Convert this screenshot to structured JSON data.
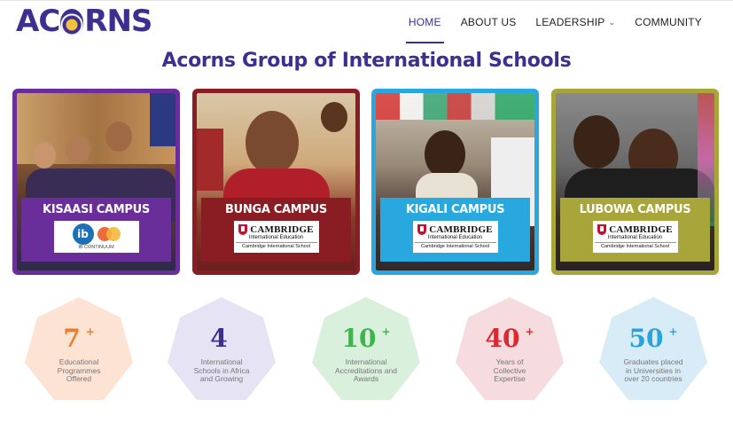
{
  "brand": {
    "logo_text_left": "AC",
    "logo_text_right": "RNS"
  },
  "nav": {
    "items": [
      {
        "label": "HOME",
        "active": true
      },
      {
        "label": "ABOUT US",
        "active": false
      },
      {
        "label": "LEADERSHIP",
        "active": false,
        "has_dropdown": true
      },
      {
        "label": "COMMUNITY",
        "active": false
      }
    ],
    "dropdown_icon": "chevron-down-icon"
  },
  "page": {
    "title": "Acorns Group of International Schools"
  },
  "campuses": [
    {
      "name": "KISAASI CAMPUS",
      "frame_color": "#6a2e9b",
      "badge_color": "#6a2e9b",
      "logo": "ib-mastercard",
      "ib_text": "IB CONTINUUM"
    },
    {
      "name": "BUNGA CAMPUS",
      "frame_color": "#8a1c23",
      "badge_color": "#8a1c23",
      "logo": "cambridge",
      "cambridge_word": "CAMBRIDGE",
      "cambridge_sub": "International Education",
      "cambridge_foot": "Cambridge International School"
    },
    {
      "name": "KIGALI CAMPUS",
      "frame_color": "#29a8e0",
      "badge_color": "#29a8e0",
      "logo": "cambridge",
      "cambridge_word": "CAMBRIDGE",
      "cambridge_sub": "International Education",
      "cambridge_foot": "Cambridge International School"
    },
    {
      "name": "LUBOWA CAMPUS",
      "frame_color": "#a8a53a",
      "badge_color": "#a8a53a",
      "logo": "cambridge",
      "cambridge_word": "CAMBRIDGE",
      "cambridge_sub": "International Education",
      "cambridge_foot": "Cambridge International School"
    }
  ],
  "stats": [
    {
      "value": "7",
      "plus": "+",
      "label": "Educational Programmes Offered",
      "color": "#f07b2a",
      "bg": "#fde3d4"
    },
    {
      "value": "4",
      "plus": "",
      "label": "International Schools in Africa and Growing",
      "color": "#3d2f8f",
      "bg": "#e6e4f4"
    },
    {
      "value": "10",
      "plus": "+",
      "label": "International Accreditations and Awards",
      "color": "#3cb54a",
      "bg": "#d9f1dc"
    },
    {
      "value": "40",
      "plus": "+",
      "label": "Years of Collective Expertise",
      "color": "#e0262f",
      "bg": "#f6dcdf"
    },
    {
      "value": "50",
      "plus": "+",
      "label": "Graduates placed in Universities in over 20 countries",
      "color": "#2aa3db",
      "bg": "#d8ecf8"
    }
  ]
}
